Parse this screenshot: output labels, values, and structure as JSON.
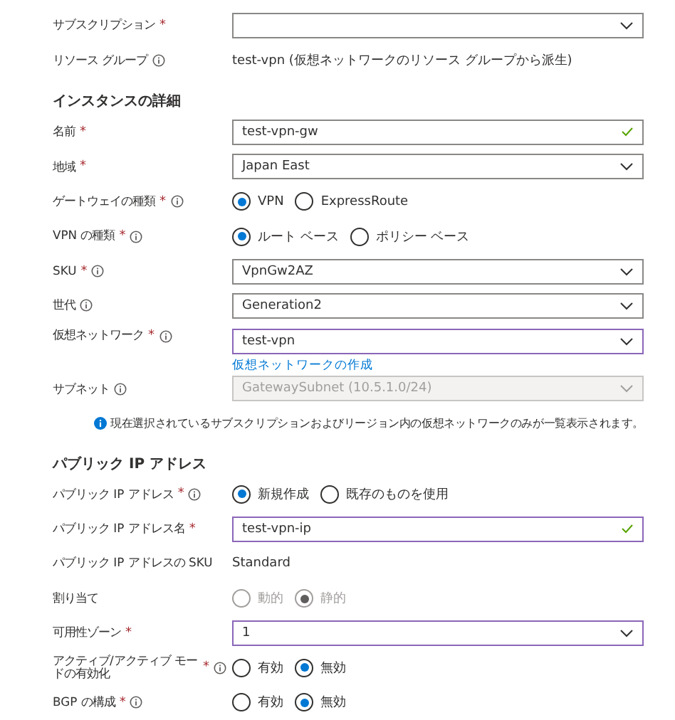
{
  "rows": [
    {
      "kind": "field",
      "label": "サブスクリプション",
      "mark": "*",
      "info": false,
      "control": {
        "kind": "dropdown",
        "focused": false,
        "disabled": false
      }
    },
    {
      "kind": "field",
      "label": "リソース グループ",
      "info": true,
      "control": {
        "kind": "static",
        "value": "test-vpn (仮想ネットワークのリソース グループから派生)"
      }
    },
    {
      "kind": "heading",
      "text": "インスタンスの詳細"
    },
    {
      "kind": "field",
      "label": "名前",
      "mark": "*",
      "info": false,
      "control": {
        "kind": "textbox",
        "value": "test-vpn-gw",
        "valid": true,
        "focused": false
      }
    },
    {
      "kind": "field",
      "label": "地域",
      "mark": "*",
      "info": false,
      "control": {
        "kind": "dropdown",
        "value": "Japan East",
        "focused": false,
        "disabled": false
      }
    },
    {
      "kind": "field",
      "label": "ゲートウェイの種類",
      "mark": "*",
      "info": true,
      "control": {
        "kind": "radio",
        "disabled": false,
        "options": [
          {
            "label": "VPN",
            "selected": true
          },
          {
            "label": "ExpressRoute",
            "selected": false
          }
        ]
      }
    },
    {
      "kind": "field",
      "label": "VPN の種類",
      "mark": "*",
      "info": true,
      "control": {
        "kind": "radio",
        "disabled": false,
        "options": [
          {
            "label": "ルート ベース",
            "selected": true
          },
          {
            "label": "ポリシー ベース",
            "selected": false
          }
        ]
      }
    },
    {
      "kind": "field",
      "label": "SKU",
      "mark": "*",
      "info": true,
      "control": {
        "kind": "dropdown",
        "value": "VpnGw2AZ",
        "focused": false,
        "disabled": false
      }
    },
    {
      "kind": "field",
      "label": "世代",
      "info": true,
      "control": {
        "kind": "dropdown",
        "value": "Generation2",
        "focused": false,
        "disabled": false
      }
    },
    {
      "kind": "field",
      "label": "仮想ネットワーク",
      "mark": "*",
      "info": true,
      "control": {
        "kind": "dropdown",
        "value": "test-vpn",
        "focused": true,
        "disabled": false,
        "link": "仮想ネットワークの作成"
      }
    },
    {
      "kind": "field",
      "label": "サブネット",
      "info": true,
      "control": {
        "kind": "dropdown",
        "value": "GatewaySubnet (10.5.1.0/24)",
        "focused": false,
        "disabled": true
      }
    },
    {
      "kind": "note",
      "text": "現在選択されているサブスクリプションおよびリージョン内の仮想ネットワークのみが一覧表示されます。"
    },
    {
      "kind": "heading",
      "text": "パブリック IP アドレス"
    },
    {
      "kind": "field",
      "label": "パブリック IP アドレス",
      "mark": "*",
      "info": true,
      "control": {
        "kind": "radio",
        "disabled": false,
        "options": [
          {
            "label": "新規作成",
            "selected": true
          },
          {
            "label": "既存のものを使用",
            "selected": false
          }
        ]
      }
    },
    {
      "kind": "field",
      "label": "パブリック IP アドレス名",
      "mark": "*",
      "info": false,
      "control": {
        "kind": "textbox",
        "value": "test-vpn-ip",
        "valid": true,
        "focused": true
      }
    },
    {
      "kind": "field",
      "label": "パブリック IP アドレスの SKU",
      "info": false,
      "control": {
        "kind": "static",
        "value": "Standard"
      }
    },
    {
      "kind": "field",
      "label": "割り当て",
      "info": false,
      "control": {
        "kind": "radio",
        "disabled": true,
        "options": [
          {
            "label": "動的",
            "selected": false
          },
          {
            "label": "静的",
            "selected": true
          }
        ]
      }
    },
    {
      "kind": "field",
      "label": "可用性ゾーン",
      "mark": "*",
      "info": false,
      "control": {
        "kind": "dropdown",
        "value": "1",
        "focused": true,
        "disabled": false
      }
    },
    {
      "kind": "field",
      "label": "アクティブ/アクティブ モードの有効化",
      "mark": "*",
      "info": true,
      "control": {
        "kind": "radio",
        "disabled": false,
        "options": [
          {
            "label": "有効",
            "selected": false
          },
          {
            "label": "無効",
            "selected": true
          }
        ]
      }
    },
    {
      "kind": "field",
      "label": "BGP の構成",
      "mark": "*",
      "info": true,
      "control": {
        "kind": "radio",
        "disabled": false,
        "options": [
          {
            "label": "有効",
            "selected": false
          },
          {
            "label": "無効",
            "selected": true
          }
        ]
      }
    }
  ]
}
